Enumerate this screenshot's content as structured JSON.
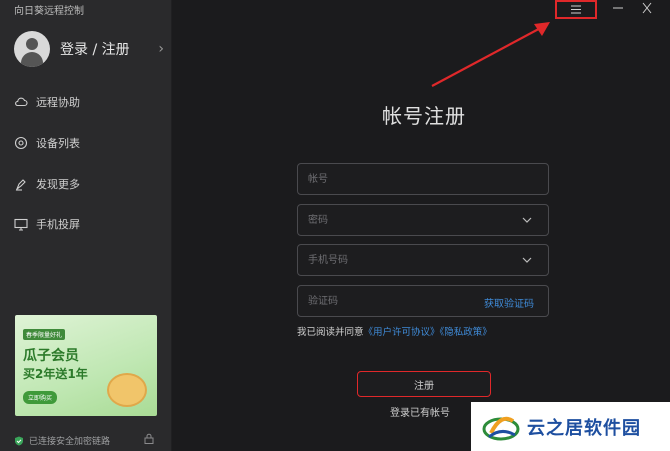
{
  "app": {
    "title": "向日葵远程控制"
  },
  "sidebar": {
    "login_label": "登录 / 注册",
    "items": [
      {
        "label": "远程协助",
        "icon": "cloud-icon"
      },
      {
        "label": "设备列表",
        "icon": "devices-icon"
      },
      {
        "label": "发现更多",
        "icon": "discover-icon"
      },
      {
        "label": "手机投屏",
        "icon": "screen-cast-icon"
      }
    ],
    "promo": {
      "tag": "春季限量好礼",
      "title": "瓜子会员",
      "subtitle": "买2年送1年",
      "button": "立即购买"
    },
    "security_status": "已连接安全加密链路"
  },
  "register": {
    "title": "帐号注册",
    "account_placeholder": "帐号",
    "password_placeholder": "密码",
    "phone_placeholder": "手机号码",
    "code_placeholder": "验证码",
    "get_code": "获取验证码",
    "agree_prefix": "我已阅读并同意",
    "user_agreement": "《用户许可协议》",
    "privacy_policy": "《隐私政策》",
    "register_button": "注册",
    "login_existing": "登录已有帐号"
  },
  "watermark": {
    "text": "云之居软件园"
  },
  "colors": {
    "accent_red": "#e0282a",
    "link_blue": "#3f8bd8",
    "sidebar_bg": "#2a2a2c",
    "main_bg": "#1b1b1d"
  }
}
